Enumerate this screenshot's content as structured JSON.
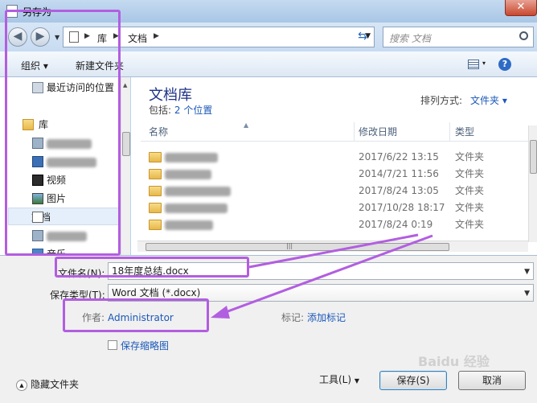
{
  "window": {
    "title": "另存为",
    "close_glyph": "✕"
  },
  "address": {
    "segments": [
      "库",
      "文档"
    ],
    "search_placeholder": "搜索 文档"
  },
  "toolbar": {
    "organize": "组织 ▾",
    "new_folder": "新建文件夹",
    "help": "?"
  },
  "nav": {
    "items": [
      {
        "label": "最近访问的位置",
        "icon": "recent-places-icon"
      },
      {
        "label": "库",
        "icon": "library-icon"
      },
      {
        "label": "",
        "icon": "library-item-icon",
        "blurred": true
      },
      {
        "label": "",
        "icon": "library-item-icon",
        "blurred": true
      },
      {
        "label": "视频",
        "icon": "video-icon"
      },
      {
        "label": "图片",
        "icon": "picture-icon"
      },
      {
        "label": "文档",
        "icon": "document-icon",
        "selected": true
      },
      {
        "label": "",
        "icon": "library-item-icon",
        "blurred": true
      },
      {
        "label": "音乐",
        "icon": "music-icon"
      }
    ]
  },
  "library": {
    "title": "文档库",
    "includes_label": "包括:",
    "includes_link": "2 个位置",
    "arrange_label": "排列方式:",
    "arrange_value": "文件夹 ▾"
  },
  "columns": {
    "name": "名称",
    "date": "修改日期",
    "type": "类型"
  },
  "files": [
    {
      "date": "2017/6/22 13:15",
      "type": "文件夹"
    },
    {
      "date": "2014/7/21 11:56",
      "type": "文件夹"
    },
    {
      "date": "2017/8/24 13:05",
      "type": "文件夹"
    },
    {
      "date": "2017/10/28 18:17",
      "type": "文件夹"
    },
    {
      "date": "2017/8/24 0:19",
      "type": "文件夹"
    }
  ],
  "form": {
    "filename_label": "文件名(N):",
    "filename_value": "18年度总结.docx",
    "filetype_label": "保存类型(T):",
    "filetype_value": "Word 文档 (*.docx)",
    "author_label": "作者:",
    "author_value": "Administrator",
    "tags_label": "标记:",
    "tags_value": "添加标记",
    "thumbnail_label": "保存缩略图"
  },
  "buttons": {
    "tools": "工具(L)",
    "save": "保存(S)",
    "cancel": "取消",
    "hide_folders": "隐藏文件夹"
  },
  "watermark": "Baidu 经验",
  "colors": {
    "highlight": "#b25ee0",
    "link": "#1b58b8",
    "library_title": "#1e3287"
  }
}
